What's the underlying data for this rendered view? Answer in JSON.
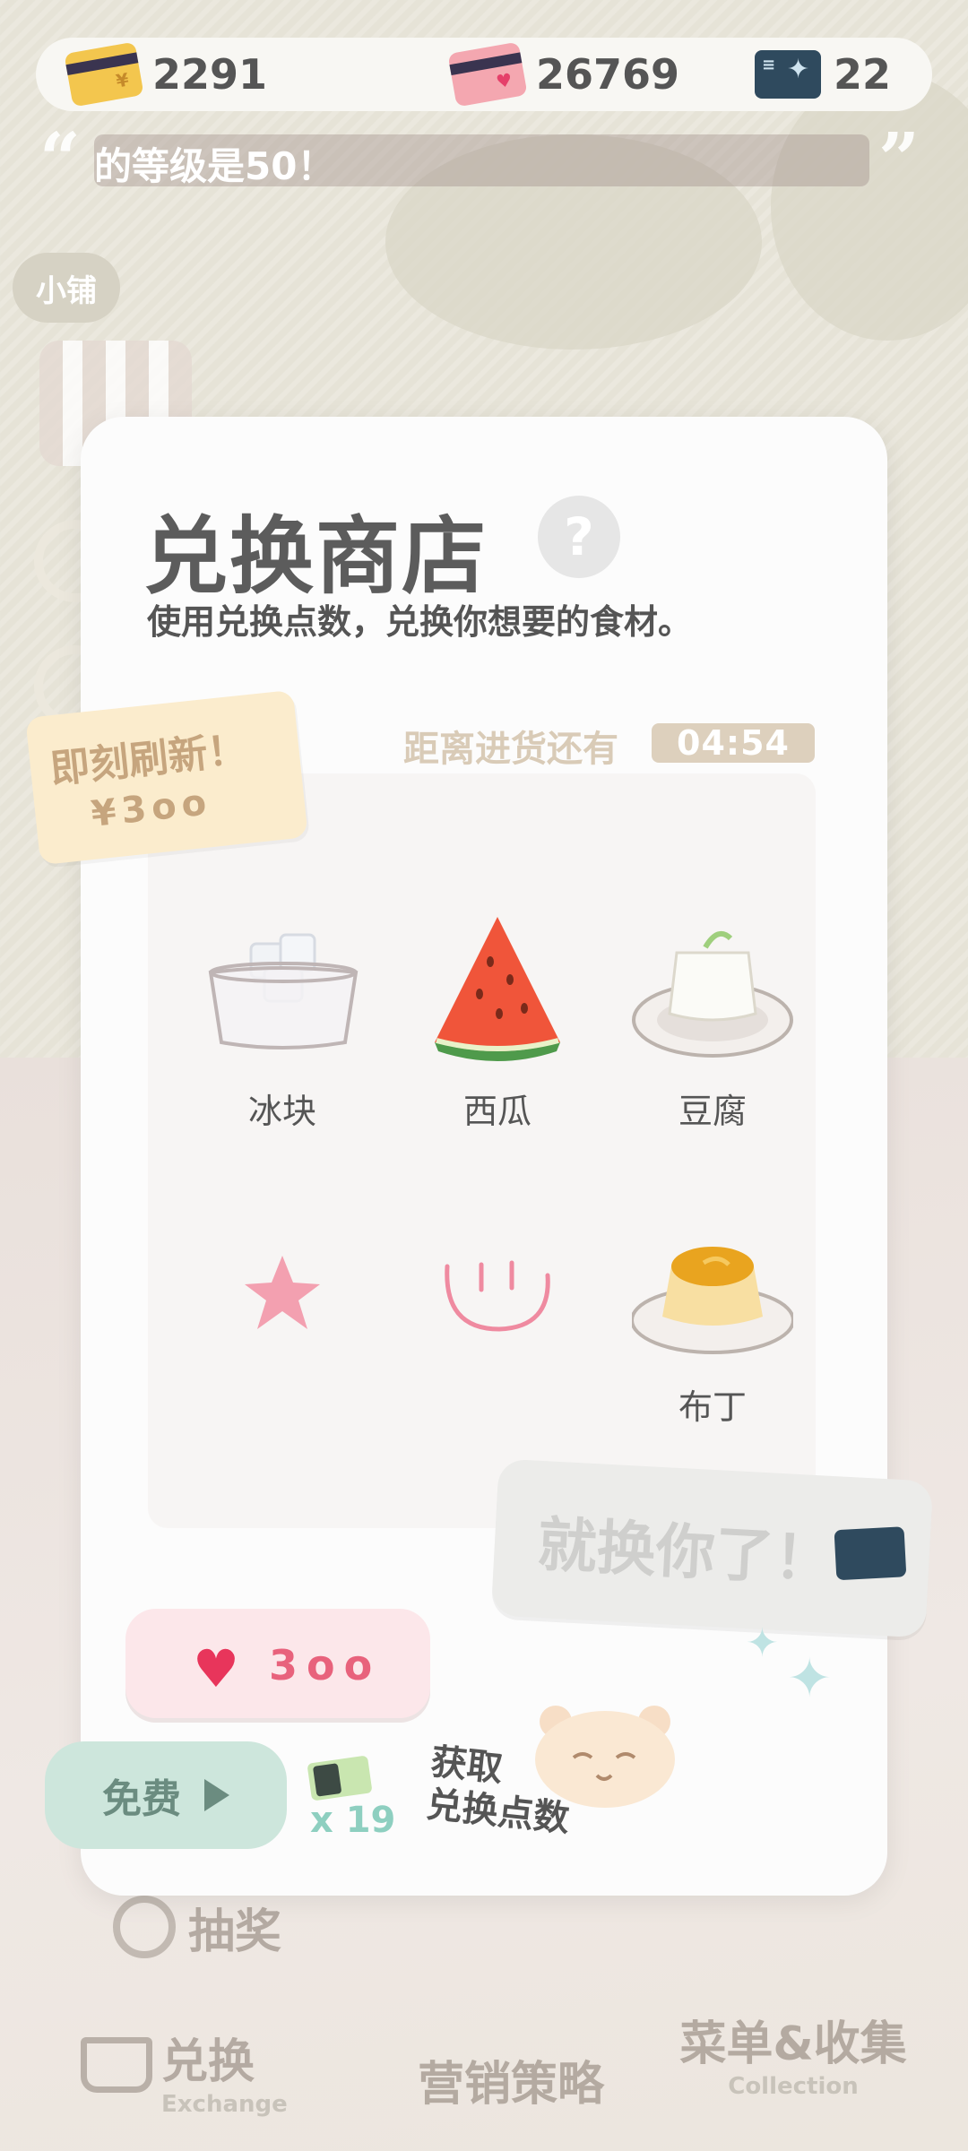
{
  "currencies": {
    "gold": {
      "value": "2291",
      "icon": "gold-card-icon",
      "color": "#f3c64e"
    },
    "pink": {
      "value": "26769",
      "icon": "pink-card-icon",
      "color": "#f4a7b0"
    },
    "ticket": {
      "value": "22",
      "icon": "exchange-ticket-icon",
      "color": "#2f4a5e"
    }
  },
  "ticker": {
    "text": "的等级是50！"
  },
  "side": {
    "shop_label": "小铺"
  },
  "modal": {
    "title": "兑换商店",
    "help": "?",
    "subtitle": "使用兑换点数，兑换你想要的食材。",
    "restock_label": "距离进货还有",
    "restock_timer": "04:54"
  },
  "refresh": {
    "line1": "即刻刷新！",
    "line2": "¥3oo"
  },
  "items": [
    {
      "name": "冰块",
      "icon": "ice-cubes-icon"
    },
    {
      "name": "西瓜",
      "icon": "watermelon-icon"
    },
    {
      "name": "豆腐",
      "icon": "tofu-icon"
    },
    {
      "name": "",
      "icon": "star-doodle-icon"
    },
    {
      "name": "",
      "icon": "smiley-doodle-icon"
    },
    {
      "name": "布丁",
      "icon": "pudding-icon"
    }
  ],
  "exchange": {
    "label": "就换你了！"
  },
  "cost": {
    "amount": "3oo",
    "icon": "heart-icon"
  },
  "free": {
    "label": "免费"
  },
  "tickets": {
    "count": "x 19"
  },
  "get_points": {
    "line1": "获取",
    "line2": "兑换点数"
  },
  "bottom_nav": {
    "lottery": "抽奖",
    "exchange": "兑换",
    "exchange_sub": "Exchange",
    "marketing": "营销策略",
    "menu": "菜单&收集",
    "menu_sub": "Collection"
  }
}
